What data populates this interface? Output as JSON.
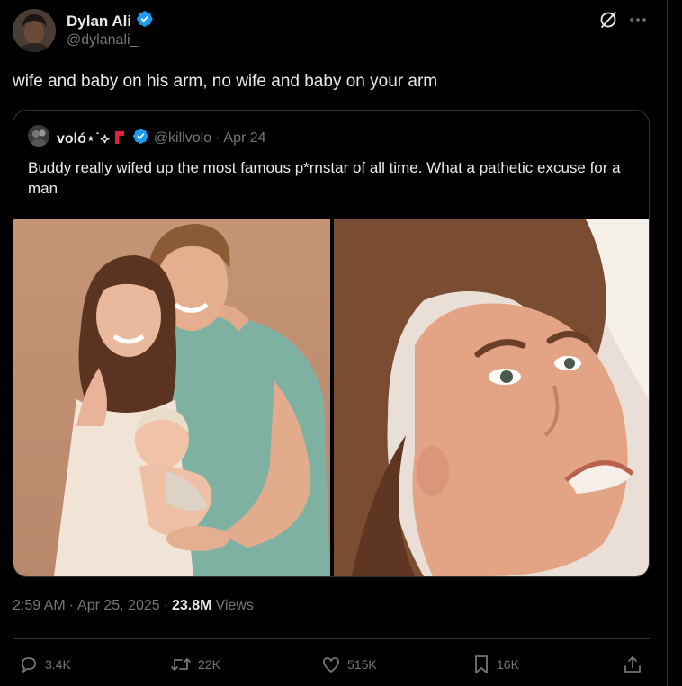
{
  "author": {
    "name": "Dylan Ali",
    "handle": "@dylanali_"
  },
  "tweet": {
    "text": "wife and baby on his arm, no wife and baby on your arm"
  },
  "quote": {
    "name": "voló⋆˙⟡",
    "handle": "@killvolo",
    "separator": "·",
    "date": "Apr 24",
    "text": "Buddy really wifed up the most famous p*rnstar of all time. What a pathetic excuse for a man"
  },
  "meta": {
    "time": "2:59 AM",
    "sep1": "·",
    "date": "Apr 25, 2025",
    "sep2": "·",
    "views_count": "23.8M",
    "views_label": "Views"
  },
  "actions": {
    "replies": "3.4K",
    "reposts": "22K",
    "likes": "515K",
    "bookmarks": "16K"
  },
  "icons": {
    "verified": "verified-badge-icon",
    "grok": "grok-icon",
    "more": "more-icon",
    "reply": "reply-icon",
    "repost": "repost-icon",
    "like": "heart-icon",
    "bookmark": "bookmark-icon",
    "share": "share-icon"
  },
  "colors": {
    "background": "#000000",
    "text": "#e7e9ea",
    "muted": "#71767b",
    "border": "#2f3336",
    "verified": "#1d9bf0",
    "flag_red": "#e0203a"
  }
}
